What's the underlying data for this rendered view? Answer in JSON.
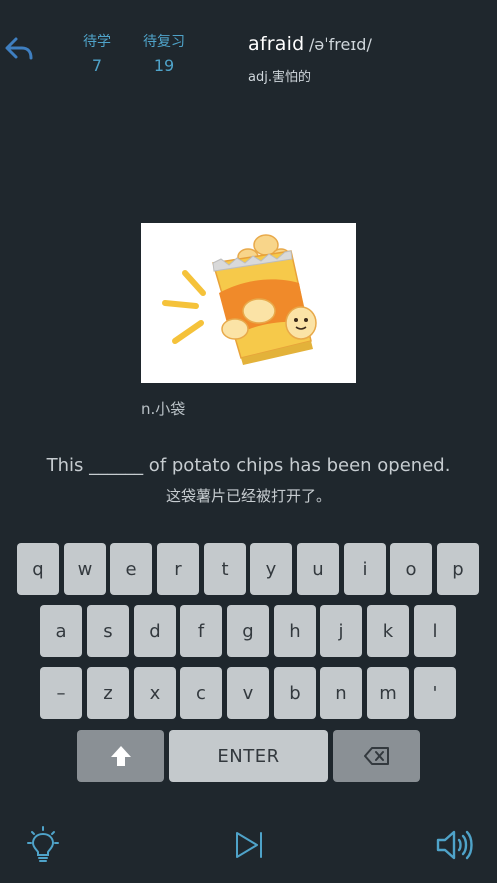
{
  "header": {
    "stats": [
      {
        "label": "待学",
        "value": "7"
      },
      {
        "label": "待复习",
        "value": "19"
      }
    ],
    "word": "afraid",
    "phonetic": "/əˈfreɪd/",
    "definition": "adj.害怕的"
  },
  "card": {
    "image_icon": "potato-chips-bag-icon",
    "meaning": "n.小袋"
  },
  "example": {
    "sentence": "This ______ of potato chips has been opened.",
    "translation": "这袋薯片已经被打开了。"
  },
  "keyboard": {
    "row1": [
      "q",
      "w",
      "e",
      "r",
      "t",
      "y",
      "u",
      "i",
      "o",
      "p"
    ],
    "row2": [
      "a",
      "s",
      "d",
      "f",
      "g",
      "h",
      "j",
      "k",
      "l"
    ],
    "row3": [
      "–",
      "z",
      "x",
      "c",
      "v",
      "b",
      "n",
      "m",
      "'"
    ],
    "enter_label": "ENTER",
    "shift_icon": "shift-arrow-icon",
    "backspace_icon": "backspace-icon"
  },
  "bottom_bar": {
    "hint_icon": "lightbulb-icon",
    "skip_icon": "skip-next-icon",
    "sound_icon": "speaker-icon"
  },
  "colors": {
    "background": "#1f272d",
    "accent": "#4fa3c9",
    "key": "#c4c9cc",
    "key_dark": "#8a9095"
  }
}
